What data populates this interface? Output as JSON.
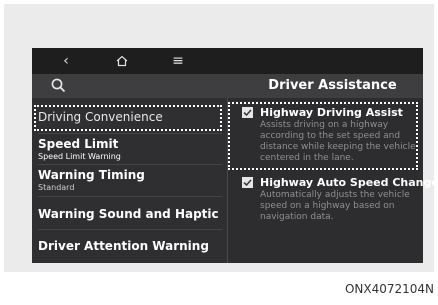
{
  "topbar": {
    "back_icon": "‹",
    "home_icon": "home-icon",
    "menu_icon": "≡"
  },
  "header": {
    "title": "Driver Assistance"
  },
  "left_menu": {
    "items": [
      {
        "label": "Driving Convenience",
        "sub": ""
      },
      {
        "label": "Speed Limit",
        "sub": "Speed Limit Warning"
      },
      {
        "label": "Warning Timing",
        "sub": "Standard"
      },
      {
        "label": "Warning Sound and Haptic",
        "sub": ""
      },
      {
        "label": "Driver Attention Warning",
        "sub": ""
      }
    ]
  },
  "options": [
    {
      "label": "Highway Driving Assist",
      "checked": true,
      "desc": "Assists driving on a highway according to the set speed and distance while keeping the vehicle centered in the lane."
    },
    {
      "label": "Highway Auto Speed Change",
      "checked": true,
      "desc": "Automatically adjusts the vehicle speed on a highway based on navigation data."
    }
  ],
  "caption": "ONX4072104N"
}
